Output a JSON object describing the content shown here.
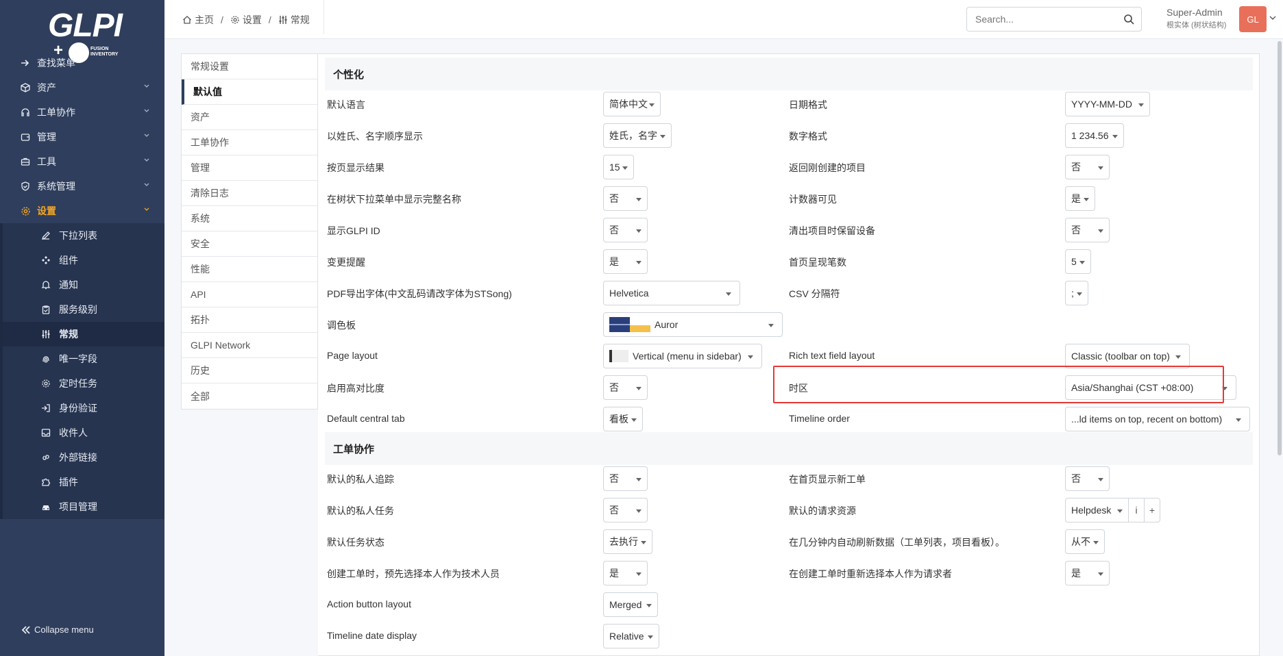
{
  "sidebar": {
    "logo": {
      "main": "GLPI",
      "plus": "+",
      "sub": "FUSION\nINVENTORY"
    },
    "menu": [
      {
        "label": "查找菜单",
        "icon": "arrow-right-icon"
      },
      {
        "label": "资产",
        "icon": "box-icon"
      },
      {
        "label": "工单协作",
        "icon": "headset-icon"
      },
      {
        "label": "管理",
        "icon": "wallet-icon"
      },
      {
        "label": "工具",
        "icon": "briefcase-icon"
      },
      {
        "label": "系统管理",
        "icon": "shield-icon"
      },
      {
        "label": "设置",
        "icon": "gear-icon"
      }
    ],
    "submenu": [
      {
        "label": "下拉列表",
        "icon": "edit-icon"
      },
      {
        "label": "组件",
        "icon": "components-icon"
      },
      {
        "label": "通知",
        "icon": "bell-icon"
      },
      {
        "label": "服务级别",
        "icon": "clipboard-icon"
      },
      {
        "label": "常规",
        "icon": "sliders-icon"
      },
      {
        "label": "唯一字段",
        "icon": "fingerprint-icon"
      },
      {
        "label": "定时任务",
        "icon": "cog-icon"
      },
      {
        "label": "身份验证",
        "icon": "login-icon"
      },
      {
        "label": "收件人",
        "icon": "inbox-icon"
      },
      {
        "label": "外部链接",
        "icon": "link-icon"
      },
      {
        "label": "插件",
        "icon": "puzzle-icon"
      },
      {
        "label": "项目管理",
        "icon": "car-icon"
      }
    ],
    "collapse_label": "Collapse menu"
  },
  "header": {
    "breadcrumb": [
      "主页",
      "设置",
      "常规"
    ],
    "search_placeholder": "Search...",
    "user_name": "Super-Admin",
    "user_entity": "根实体 (树状结构)",
    "avatar_initials": "GL"
  },
  "tabs": [
    "常规设置",
    "默认值",
    "资产",
    "工单协作",
    "管理",
    "清除日志",
    "系统",
    "安全",
    "性能",
    "API",
    "拓扑",
    "GLPI Network",
    "历史",
    "全部"
  ],
  "sections": {
    "personalization": "个性化",
    "assistance": "工单协作"
  },
  "left_rows": [
    {
      "label": "默认语言",
      "value": "简体中文"
    },
    {
      "label": "以姓氏、名字顺序显示",
      "value": "姓氏，名字"
    },
    {
      "label": "按页显示结果",
      "value": "15"
    },
    {
      "label": "在树状下拉菜单中显示完整名称",
      "value": "否"
    },
    {
      "label": "显示GLPI ID",
      "value": "否"
    },
    {
      "label": "变更提醒",
      "value": "是"
    },
    {
      "label": "PDF导出字体(中文乱码请改字体为STSong)",
      "value": "Helvetica"
    },
    {
      "label": "调色板",
      "value": "Auror"
    },
    {
      "label": "Page layout",
      "value": "Vertical (menu in sidebar)"
    },
    {
      "label": "启用高对比度",
      "value": "否"
    },
    {
      "label": "Default central tab",
      "value": "看板"
    }
  ],
  "right_rows": [
    {
      "label": "日期格式",
      "value": "YYYY-MM-DD"
    },
    {
      "label": "数字格式",
      "value": "1 234.56"
    },
    {
      "label": "返回刚创建的项目",
      "value": "否"
    },
    {
      "label": "计数器可见",
      "value": "是"
    },
    {
      "label": "清出项目时保留设备",
      "value": "否"
    },
    {
      "label": "首页呈现笔数",
      "value": "5"
    },
    {
      "label": "CSV 分隔符",
      "value": ";"
    },
    {
      "label": "",
      "value": ""
    },
    {
      "label": "Rich text field layout",
      "value": "Classic (toolbar on top)"
    },
    {
      "label": "时区",
      "value": "Asia/Shanghai (CST +08:00)"
    },
    {
      "label": "Timeline order",
      "value": "...ld items on top, recent on bottom)"
    }
  ],
  "assist_left": [
    {
      "label": "默认的私人追踪",
      "value": "否"
    },
    {
      "label": "默认的私人任务",
      "value": "否"
    },
    {
      "label": "默认任务状态",
      "value": "去执行"
    },
    {
      "label": "创建工单时，预先选择本人作为技术人员",
      "value": "是"
    },
    {
      "label": "Action button layout",
      "value": "Merged"
    },
    {
      "label": "Timeline date display",
      "value": "Relative"
    }
  ],
  "assist_right": [
    {
      "label": "在首页显示新工单",
      "value": "否"
    },
    {
      "label": "默认的请求资源",
      "value": "Helpdesk",
      "addon1": "i",
      "addon2": "+"
    },
    {
      "label": "在几分钟内自动刷新数据（工单列表，项目看板）。",
      "value": "从不"
    },
    {
      "label": "在创建工单时重新选择本人作为请求者",
      "value": "是"
    }
  ],
  "colors": {
    "sidebar": "#2f3e5c",
    "accent": "#f5a623",
    "highlight": "#e53935",
    "avatar": "#e8705a"
  }
}
